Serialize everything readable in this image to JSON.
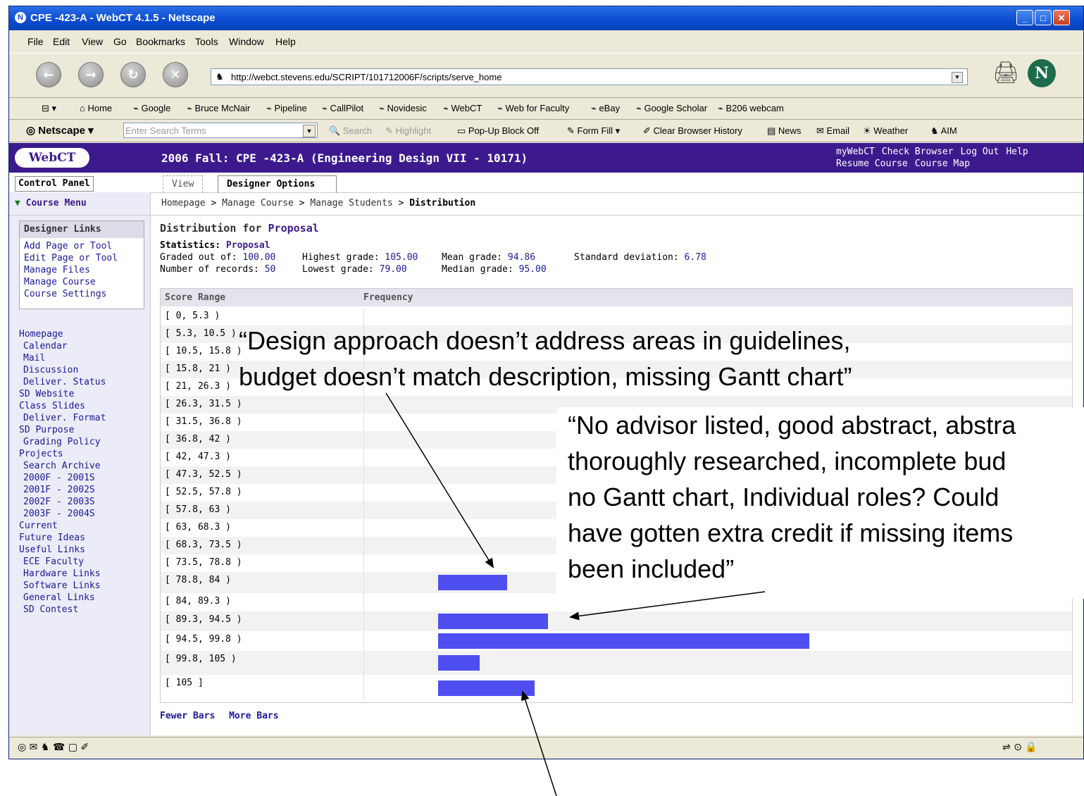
{
  "window": {
    "title": "CPE -423-A - WebCT 4.1.5 - Netscape"
  },
  "menu": [
    "File",
    "Edit",
    "View",
    "Go",
    "Bookmarks",
    "Tools",
    "Window",
    "Help"
  ],
  "address": {
    "url": "http://webct.stevens.edu/SCRIPT/101712006F/scripts/serve_home"
  },
  "bookmarks": [
    "Home",
    "Google",
    "Bruce McNair",
    "Pipeline",
    "CallPilot",
    "Novidesic",
    "WebCT",
    "Web for Faculty",
    "eBay",
    "Google Scholar",
    "B206 webcam"
  ],
  "searchbar": {
    "brand": "Netscape",
    "placeholder": "Enter Search Terms",
    "items": [
      "Search",
      "Highlight",
      "Pop-Up Block Off",
      "Form Fill",
      "Clear Browser History",
      "News",
      "Email",
      "Weather",
      "AIM"
    ]
  },
  "webct": {
    "logo": "WebCT",
    "course_title": "2006 Fall: CPE -423-A (Engineering Design VII - 10171)",
    "links_row1": [
      "myWebCT",
      "Check Browser",
      "Log Out",
      "Help"
    ],
    "links_row2": [
      "Resume Course",
      "Course Map"
    ],
    "control_panel": "Control Panel",
    "tab_view": "View",
    "tab_designer": "Designer Options",
    "course_menu": "Course Menu",
    "breadcrumb": {
      "home": "Homepage",
      "sep": " > ",
      "manage": "Manage Course",
      "students": "Manage Students",
      "current": "Distribution"
    }
  },
  "sidebar": {
    "designer_links_title": "Designer Links",
    "designer_links": [
      "Add Page or Tool",
      "Edit Page or Tool",
      "Manage Files",
      "Manage Course",
      "Course Settings"
    ],
    "items": [
      "Homepage",
      "Calendar",
      "Mail",
      "Discussion",
      "Deliver. Status",
      "SD Website",
      "Class Slides",
      "Deliver. Format",
      "SD Purpose",
      "Grading Policy",
      "Projects",
      "Search Archive",
      "2000F - 2001S",
      "2001F - 2002S",
      "2002F - 2003S",
      "2003F - 2004S",
      "Current",
      "Future Ideas",
      "Useful Links",
      "ECE Faculty",
      "Hardware Links",
      "Software Links",
      "General Links",
      "SD Contest"
    ]
  },
  "stats": {
    "heading_prefix": "Distribution for ",
    "item": "Proposal",
    "stats_prefix": "Statistics: ",
    "graded_out_of_label": "Graded out of: ",
    "graded_out_of": "100.00",
    "records_label": "Number of records: ",
    "records": "50",
    "highest_label": "Highest grade: ",
    "highest": "105.00",
    "lowest_label": "Lowest grade: ",
    "lowest": "79.00",
    "mean_label": "Mean grade: ",
    "mean": "94.86",
    "median_label": "Median grade: ",
    "median": "95.00",
    "sd_label": "Standard deviation: ",
    "sd": "6.78"
  },
  "table": {
    "col_range": "Score Range",
    "col_freq": "Frequency",
    "max_freq": 27,
    "rows": [
      {
        "range": "[ 0, 5.3 )",
        "freq": 0
      },
      {
        "range": "[ 5.3, 10.5 )",
        "freq": 0
      },
      {
        "range": "[ 10.5, 15.8 )",
        "freq": 0
      },
      {
        "range": "[ 15.8, 21 )",
        "freq": 0
      },
      {
        "range": "[ 21, 26.3 )",
        "freq": 0
      },
      {
        "range": "[ 26.3, 31.5 )",
        "freq": 0
      },
      {
        "range": "[ 31.5, 36.8 )",
        "freq": 0
      },
      {
        "range": "[ 36.8, 42 )",
        "freq": 0
      },
      {
        "range": "[ 42, 47.3 )",
        "freq": 0
      },
      {
        "range": "[ 47.3, 52.5 )",
        "freq": 0
      },
      {
        "range": "[ 52.5, 57.8 )",
        "freq": 0
      },
      {
        "range": "[ 57.8, 63 )",
        "freq": 0
      },
      {
        "range": "[ 63, 68.3 )",
        "freq": 0
      },
      {
        "range": "[ 68.3, 73.5 )",
        "freq": 0
      },
      {
        "range": "[ 73.5, 78.8 )",
        "freq": 0
      },
      {
        "range": "[ 78.8, 84 )",
        "freq": 5
      },
      {
        "range": "[ 84, 89.3 )",
        "freq": 0
      },
      {
        "range": "[ 89.3, 94.5 )",
        "freq": 8
      },
      {
        "range": "[ 94.5, 99.8 )",
        "freq": 27
      },
      {
        "range": "[ 99.8, 105 )",
        "freq": 3
      },
      {
        "range": "[ 105 ]",
        "freq": 7
      }
    ]
  },
  "footer_links": {
    "fewer": "Fewer Bars",
    "more": "More Bars"
  },
  "annotations": {
    "a1_line1": "“Design approach doesn’t address areas in guidelines,",
    "a1_line2": "budget doesn’t match description, missing Gantt chart”",
    "a2_line1": "“No advisor listed, good abstract, abstra",
    "a2_line2": "thoroughly researched, incomplete bud",
    "a2_line3": "no Gantt chart, Individual roles?  Could",
    "a2_line4": "have gotten extra credit if missing items",
    "a2_line5": "been included”"
  }
}
